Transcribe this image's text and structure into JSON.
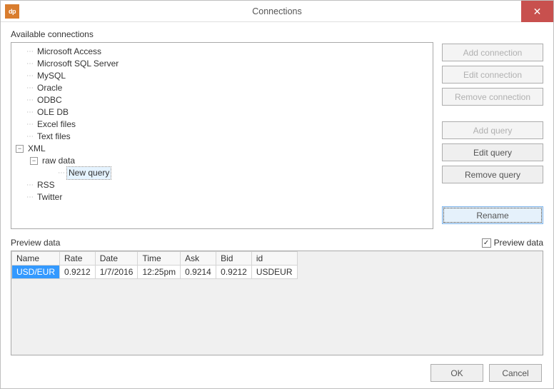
{
  "window": {
    "title": "Connections",
    "app_icon_text": "dp"
  },
  "sections": {
    "available_label": "Available connections",
    "preview_label": "Preview data"
  },
  "tree": {
    "items": [
      "Microsoft Access",
      "Microsoft SQL Server",
      "MySQL",
      "Oracle",
      "ODBC",
      "OLE DB",
      "Excel files",
      "Text files"
    ],
    "xml_label": "XML",
    "raw_data_label": "raw data",
    "new_query_label": "New query",
    "tail": [
      "RSS",
      "Twitter"
    ]
  },
  "buttons": {
    "add_connection": "Add connection",
    "edit_connection": "Edit connection",
    "remove_connection": "Remove connection",
    "add_query": "Add query",
    "edit_query": "Edit query",
    "remove_query": "Remove query",
    "rename": "Rename"
  },
  "preview_checkbox": {
    "label": "Preview data",
    "checked": true
  },
  "grid": {
    "headers": {
      "name": "Name",
      "rate": "Rate",
      "date": "Date",
      "time": "Time",
      "ask": "Ask",
      "bid": "Bid",
      "id": "id"
    },
    "row": {
      "name": "USD/EUR",
      "rate": "0.9212",
      "date": "1/7/2016",
      "time": "12:25pm",
      "ask": "0.9214",
      "bid": "0.9212",
      "id": "USDEUR"
    }
  },
  "footer": {
    "ok": "OK",
    "cancel": "Cancel"
  }
}
